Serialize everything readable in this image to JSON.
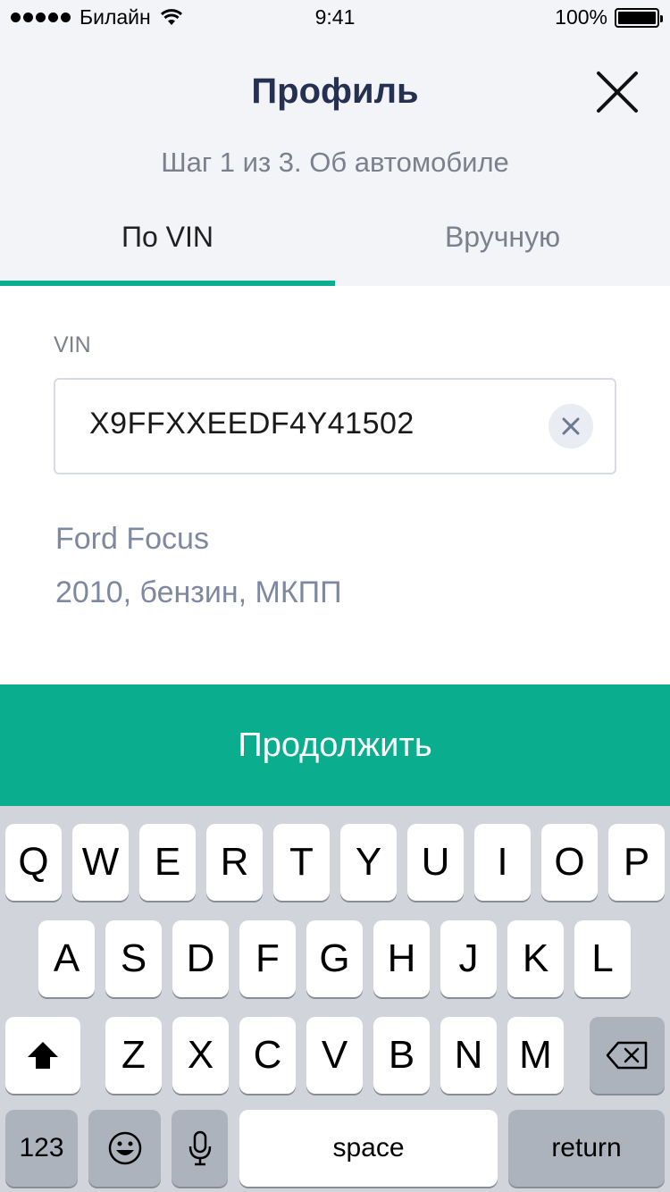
{
  "status_bar": {
    "carrier": "Билайн",
    "time": "9:41",
    "battery": "100%",
    "battery_level": 1.0
  },
  "header": {
    "title": "Профиль",
    "subtitle": "Шаг 1 из 3. Об автомобиле",
    "close_icon": "close-icon"
  },
  "tabs": [
    {
      "label": "По VIN",
      "active": true
    },
    {
      "label": "Вручную",
      "active": false
    }
  ],
  "form": {
    "vin_label": "VIN",
    "vin_value": "X9FFXXEEDF4Y41502",
    "clear_icon": "clear-icon",
    "car_model": "Ford Focus",
    "car_info": "2010, бензин, МКПП"
  },
  "continue_button": {
    "label": "Продолжить"
  },
  "keyboard": {
    "row1": [
      "Q",
      "W",
      "E",
      "R",
      "T",
      "Y",
      "U",
      "I",
      "O",
      "P"
    ],
    "row2": [
      "A",
      "S",
      "D",
      "F",
      "G",
      "H",
      "J",
      "K",
      "L"
    ],
    "row3": [
      "Z",
      "X",
      "C",
      "V",
      "B",
      "N",
      "M"
    ],
    "numbers_label": "123",
    "space_label": "space",
    "return_label": "return",
    "shift_icon": "shift-icon",
    "backspace_icon": "backspace-icon",
    "emoji_icon": "emoji-icon",
    "mic_icon": "microphone-icon"
  },
  "colors": {
    "accent": "#0aad8e",
    "header_bg": "#f2f4f8",
    "title": "#263151",
    "muted": "#7b808c",
    "car_text": "#7e88a0",
    "keyboard_bg": "#d1d5db"
  }
}
